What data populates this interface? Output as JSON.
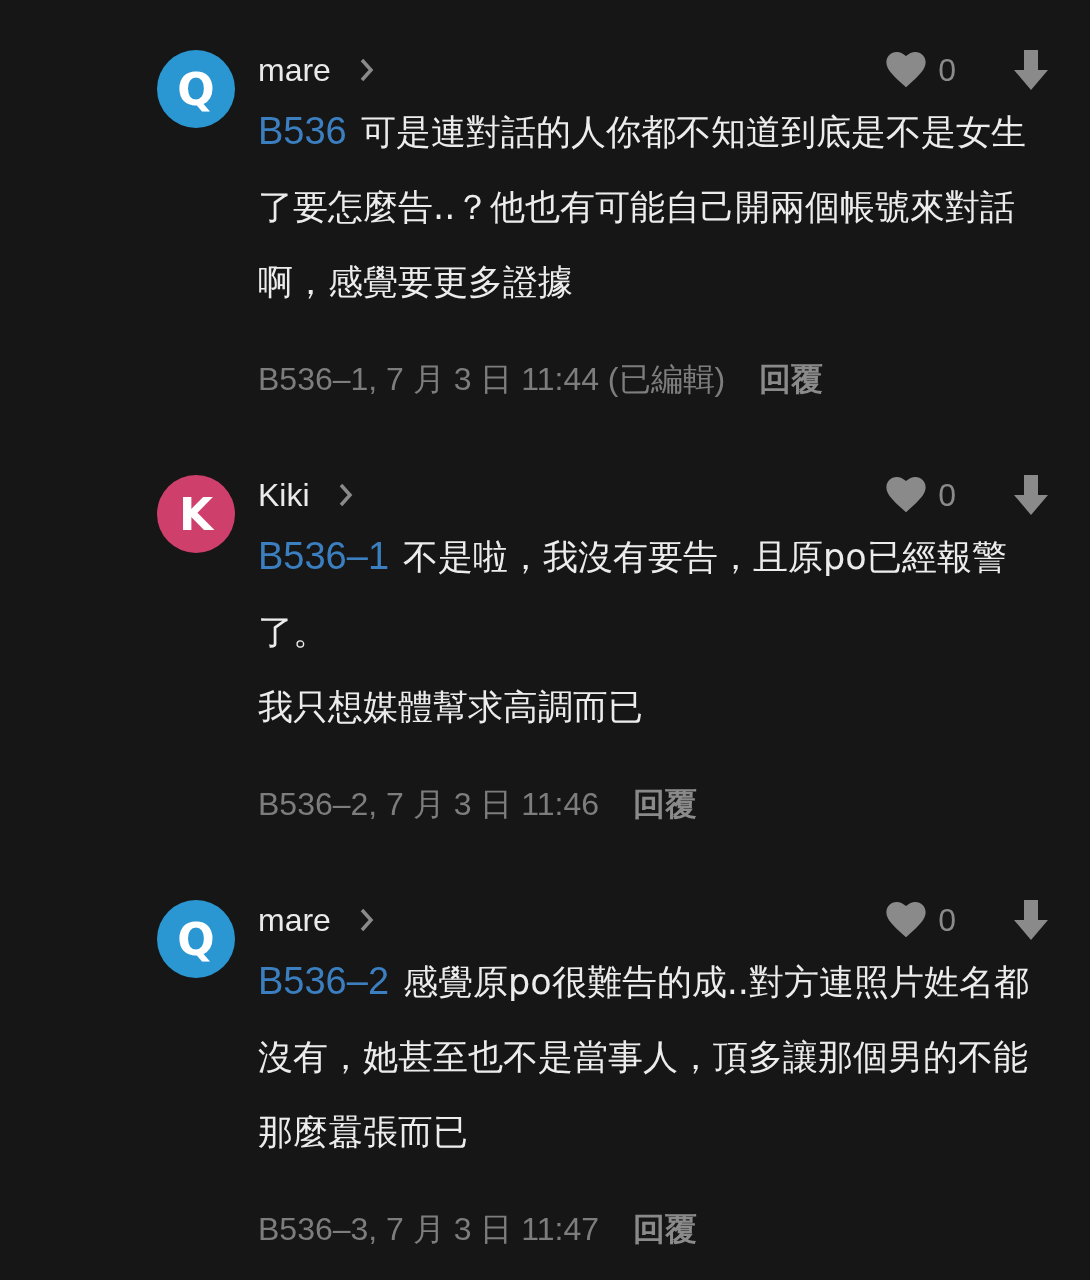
{
  "comments": [
    {
      "avatar": "Q",
      "color": "#2b97d2",
      "name": "mare",
      "likes": "0",
      "reply_to": "B536",
      "paragraphs": [
        "可是連對話的人你都不知道到底是不是女生了要怎麼告..？他也有可能自己開兩個帳號來對話啊，感覺要更多證據"
      ],
      "meta": "B536–1, 7 月 3 日 11:44 (已編輯)",
      "reply": "回覆"
    },
    {
      "avatar": "K",
      "color": "#cf3f6c",
      "name": "Kiki",
      "likes": "0",
      "reply_to": "B536–1",
      "paragraphs": [
        "不是啦，我沒有要告，且原po已經報警了。",
        "我只想媒體幫求高調而已"
      ],
      "meta": "B536–2, 7 月 3 日 11:46",
      "reply": "回覆"
    },
    {
      "avatar": "Q",
      "color": "#2b97d2",
      "name": "mare",
      "likes": "0",
      "reply_to": "B536–2",
      "paragraphs": [
        "感覺原po很難告的成..對方連照片姓名都沒有，她甚至也不是當事人，頂多讓那個男的不能那麼囂張而已"
      ],
      "meta": "B536–3, 7 月 3 日 11:47",
      "reply": "回覆"
    }
  ]
}
